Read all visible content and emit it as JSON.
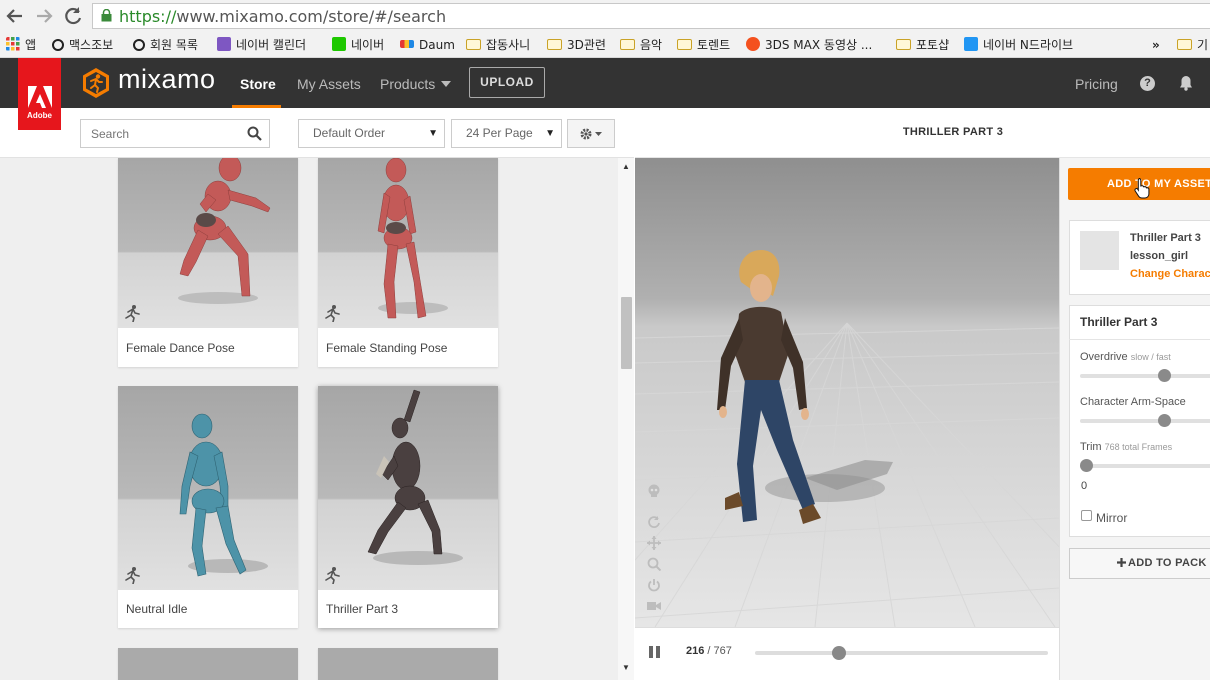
{
  "browser": {
    "url_scheme": "https://",
    "url_rest": "www.mixamo.com/store/#/search",
    "bookmarks": [
      {
        "label": "앱",
        "icon": "apps-grid-icon"
      },
      {
        "label": "맥스조보",
        "icon": "site-icon"
      },
      {
        "label": "회원 목록",
        "icon": "site-icon"
      },
      {
        "label": "네이버 캘린더",
        "icon": "calendar-icon"
      },
      {
        "label": "네이버",
        "icon": "naver-icon"
      },
      {
        "label": "Daum",
        "icon": "daum-icon"
      },
      {
        "label": "잡동사니",
        "icon": "folder-icon"
      },
      {
        "label": "3D관련",
        "icon": "folder-icon"
      },
      {
        "label": "음악",
        "icon": "folder-icon"
      },
      {
        "label": "토렌트",
        "icon": "folder-icon"
      },
      {
        "label": "3DS MAX 동영상 ...",
        "icon": "site-icon"
      },
      {
        "label": "포토샵",
        "icon": "folder-icon"
      },
      {
        "label": "네이버 N드라이브",
        "icon": "cloud-icon"
      }
    ],
    "more_bookmarks": "»",
    "other_bookmarks": "기"
  },
  "header": {
    "adobe_label": "Adobe",
    "logo_text": "mixamo",
    "nav": [
      "Store",
      "My Assets",
      "Products"
    ],
    "upload_label": "UPLOAD",
    "pricing_label": "Pricing",
    "help_glyph": "?"
  },
  "toolbar": {
    "search_placeholder": "Search",
    "order_value": "Default Order",
    "per_page_value": "24 Per Page"
  },
  "cards": [
    {
      "label": "Female Dance Pose"
    },
    {
      "label": "Female Standing Pose"
    },
    {
      "label": "Neutral Idle"
    },
    {
      "label": "Thriller Part 3"
    }
  ],
  "viewer": {
    "title": "THRILLER PART 3",
    "current_frame": "216",
    "total_frames": "/ 767"
  },
  "panel": {
    "add_assets_label": "ADD TO MY ASSETS",
    "anim_name": "Thriller Part 3",
    "char_name": "lesson_girl",
    "change_char": "Change Character",
    "settings_title": "Thriller Part 3",
    "overdrive_label": "Overdrive",
    "overdrive_hint": "slow / fast",
    "armspace_label": "Character Arm-Space",
    "trim_label": "Trim",
    "trim_hint": "768 total Frames",
    "trim_value": "0",
    "mirror_label": "Mirror",
    "add_pack_label": "ADD TO PACK",
    "colors": {
      "accent": "#f57c00",
      "topbar": "#333333",
      "adobe_red": "#e6161c"
    }
  }
}
